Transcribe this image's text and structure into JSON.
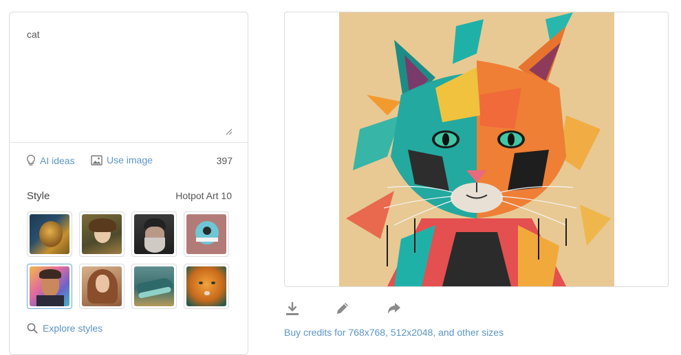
{
  "prompt": {
    "text": "cat"
  },
  "ideas": {
    "ai_ideas_label": "AI ideas",
    "use_image_label": "Use image",
    "char_count": "397"
  },
  "style": {
    "label": "Style",
    "selected_name": "Hotpot Art 10",
    "thumbnails": [
      {
        "name": "lion-style"
      },
      {
        "name": "anime-girl-style"
      },
      {
        "name": "bearded-man-style"
      },
      {
        "name": "flat-illustration-style"
      },
      {
        "name": "pop-art-portrait-style",
        "selected": true
      },
      {
        "name": "fantasy-woman-style"
      },
      {
        "name": "crocodile-style"
      },
      {
        "name": "tiger-style"
      }
    ],
    "explore_label": "Explore styles"
  },
  "result": {
    "image_subject": "colorful-cat-portrait"
  },
  "actions": {
    "icons": [
      "download-icon",
      "edit-icon",
      "share-icon"
    ]
  },
  "buy_link": {
    "text": "Buy credits for 768x768, 512x2048, and other sizes"
  },
  "colors": {
    "link": "#5b95c7",
    "border": "#dcdcdc",
    "selected_border": "#6ea6d6"
  }
}
